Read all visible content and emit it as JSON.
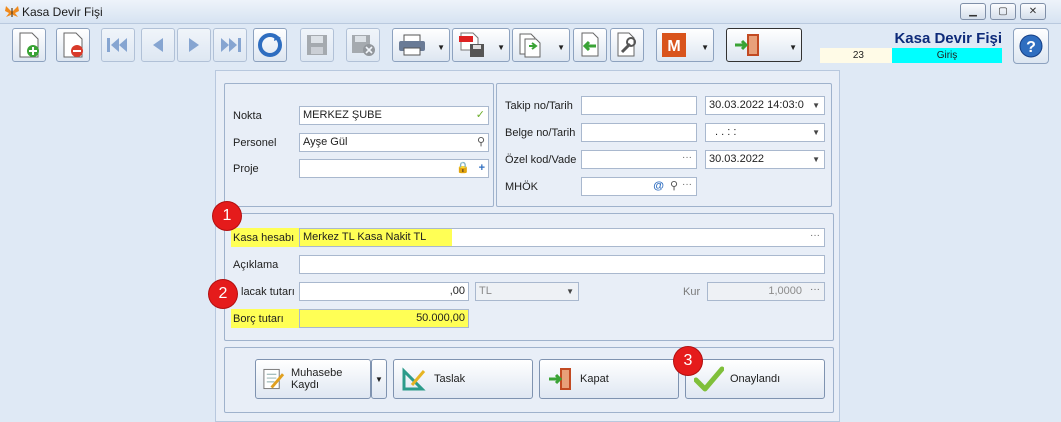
{
  "window": {
    "title": "Kasa Devir Fişi"
  },
  "header": {
    "form_title": "Kasa Devir Fişi",
    "record_no": "23",
    "mode": "Giriş"
  },
  "toolbar": {
    "icons": [
      "new-doc-icon",
      "delete-doc-icon",
      "first-record-icon",
      "prev-record-icon",
      "next-record-icon",
      "last-record-icon",
      "refresh-icon",
      "save-icon",
      "save-close-icon",
      "print-icon",
      "pdf-export-icon",
      "copy-doc-icon",
      "import-icon",
      "settings-wrench-icon",
      "m-logo-icon",
      "exit-door-icon",
      "help-icon"
    ]
  },
  "left_panel": {
    "nokta_label": "Nokta",
    "nokta_value": "MERKEZ ŞUBE",
    "personel_label": "Personel",
    "personel_value": "Ayşe Gül",
    "proje_label": "Proje",
    "proje_value": ""
  },
  "right_panel": {
    "takip_label": "Takip no/Tarih",
    "takip_value": "",
    "takip_date": "30.03.2022 14:03:0",
    "belge_label": "Belge no/Tarih",
    "belge_value": "",
    "belge_date": ". .      : :",
    "ozel_label": "Özel kod/Vade",
    "ozel_value": "",
    "vade_date": "30.03.2022",
    "mhok_label": "MHÖK",
    "mhok_value": ""
  },
  "details": {
    "kasa_label": "Kasa hesabı",
    "kasa_value": "Merkez TL Kasa Nakit TL",
    "aciklama_label": "Açıklama",
    "aciklama_value": "",
    "alacak_label": "lacak tutarı",
    "alacak_value": ",00",
    "currency": "TL",
    "kur_label": "Kur",
    "kur_value": "1,0000",
    "borc_label": "Borç tutarı",
    "borc_value": "50.000,00"
  },
  "actions": {
    "muhasebe": "Muhasebe Kaydı",
    "taslak": "Taslak",
    "kapat": "Kapat",
    "onay": "Onaylandı"
  },
  "badges": [
    "1",
    "2",
    "3"
  ],
  "colors": {
    "highlight": "#ffff55",
    "badge": "#e51b1b",
    "mode_bg": "#00ffff",
    "title": "#0e2b7a"
  }
}
